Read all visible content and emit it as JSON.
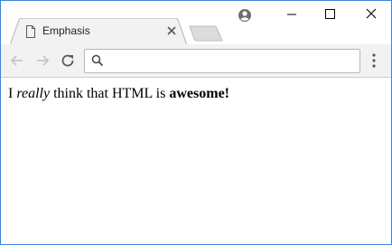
{
  "tab": {
    "title": "Emphasis"
  },
  "omnibox": {
    "value": "",
    "placeholder": ""
  },
  "page": {
    "text_before": "I ",
    "emphasis": "really",
    "text_middle": " think that HTML is ",
    "strong": "awesome!"
  },
  "icons": {
    "tab": "document-icon",
    "close_tab": "close-icon",
    "profile": "account-circle-icon",
    "minimize": "minimize-icon",
    "maximize": "maximize-icon",
    "close_window": "close-icon",
    "back": "arrow-left-icon",
    "forward": "arrow-right-icon",
    "reload": "reload-icon",
    "search": "search-icon",
    "menu": "kebab-menu-icon"
  },
  "colors": {
    "window_border": "#3c84d6",
    "toolbar_bg": "#f2f2f2",
    "tab_bg": "#f2f2f2",
    "inactive_tab": "#dcdcdc"
  }
}
